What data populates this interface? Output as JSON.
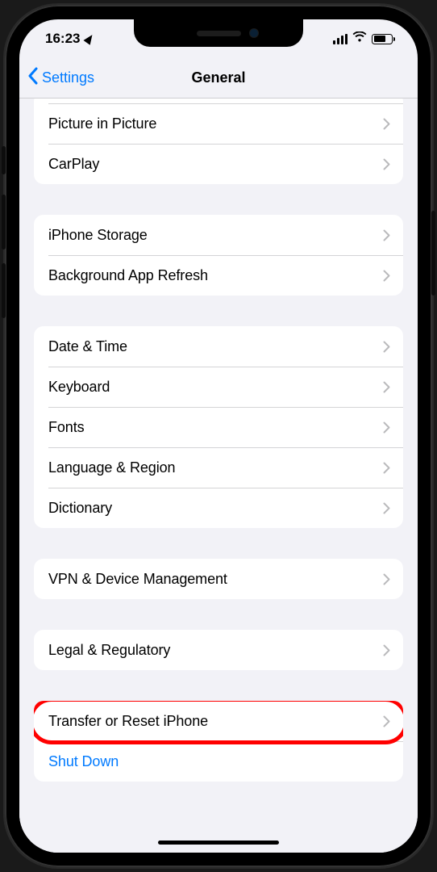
{
  "status": {
    "time": "16:23"
  },
  "nav": {
    "back_label": "Settings",
    "title": "General"
  },
  "groups": [
    {
      "partial_leading": true,
      "items": [
        {
          "label": "Picture in Picture",
          "disclosure": true,
          "name": "picture-in-picture"
        },
        {
          "label": "CarPlay",
          "disclosure": true,
          "name": "carplay"
        }
      ]
    },
    {
      "items": [
        {
          "label": "iPhone Storage",
          "disclosure": true,
          "name": "iphone-storage"
        },
        {
          "label": "Background App Refresh",
          "disclosure": true,
          "name": "background-app-refresh"
        }
      ]
    },
    {
      "items": [
        {
          "label": "Date & Time",
          "disclosure": true,
          "name": "date-time"
        },
        {
          "label": "Keyboard",
          "disclosure": true,
          "name": "keyboard"
        },
        {
          "label": "Fonts",
          "disclosure": true,
          "name": "fonts"
        },
        {
          "label": "Language & Region",
          "disclosure": true,
          "name": "language-region"
        },
        {
          "label": "Dictionary",
          "disclosure": true,
          "name": "dictionary"
        }
      ]
    },
    {
      "items": [
        {
          "label": "VPN & Device Management",
          "disclosure": true,
          "name": "vpn-device-mgmt"
        }
      ]
    },
    {
      "items": [
        {
          "label": "Legal & Regulatory",
          "disclosure": true,
          "name": "legal-regulatory"
        }
      ]
    },
    {
      "items": [
        {
          "label": "Transfer or Reset iPhone",
          "disclosure": true,
          "name": "transfer-reset",
          "highlight": true
        },
        {
          "label": "Shut Down",
          "disclosure": false,
          "name": "shut-down",
          "accent": true
        }
      ]
    }
  ]
}
